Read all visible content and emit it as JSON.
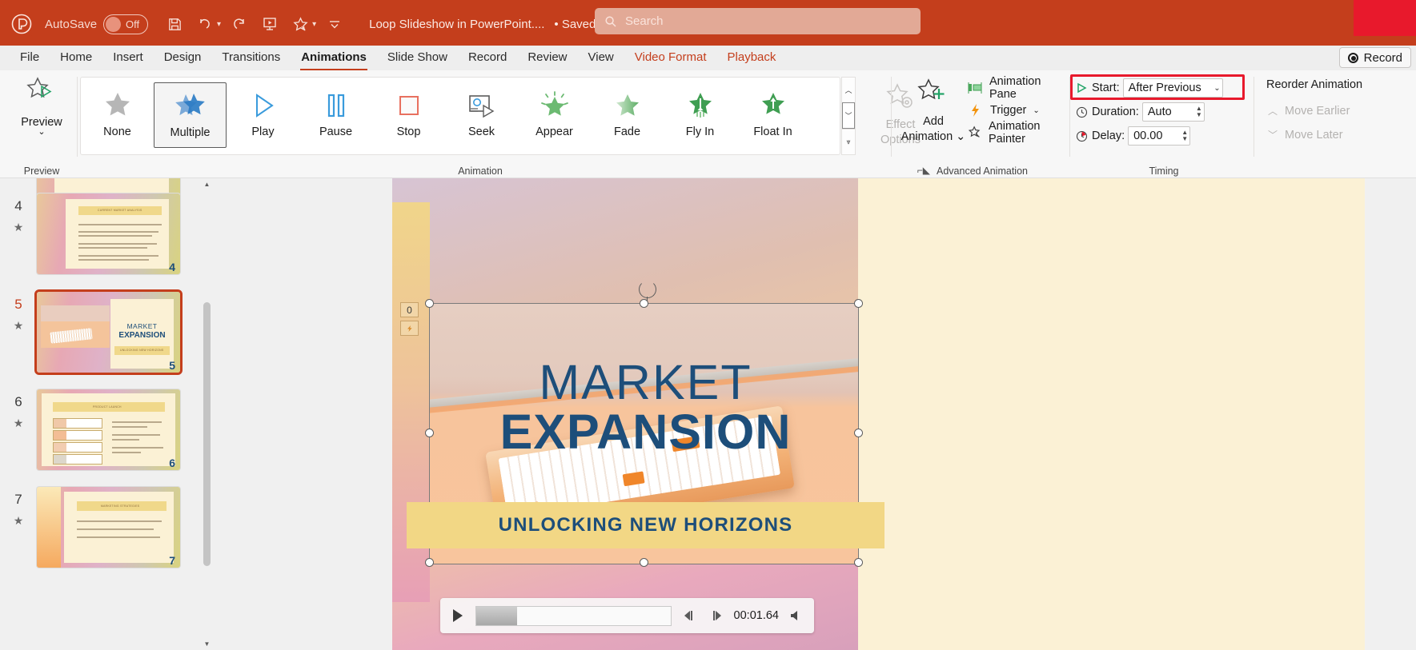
{
  "titlebar": {
    "app_icon": "powerpoint-logo-icon",
    "autosave_label": "AutoSave",
    "autosave_state": "Off",
    "quick_access": [
      {
        "name": "save-icon",
        "label": "Save"
      },
      {
        "name": "undo-icon",
        "label": "Undo"
      },
      {
        "name": "redo-icon",
        "label": "Redo"
      },
      {
        "name": "start-from-beginning-icon",
        "label": "Start From Beginning"
      },
      {
        "name": "designer-icon",
        "label": "Designer"
      },
      {
        "name": "customize-quick-access-icon",
        "label": "Customize Quick Access Toolbar"
      }
    ],
    "document_title": "Loop Slideshow in PowerPoint....",
    "saved_state": "• Saved to this PC",
    "search_placeholder": "Search",
    "accent_color": "#c43e1c"
  },
  "tabs": [
    {
      "label": "File",
      "active": false,
      "contextual": false
    },
    {
      "label": "Home",
      "active": false,
      "contextual": false
    },
    {
      "label": "Insert",
      "active": false,
      "contextual": false
    },
    {
      "label": "Design",
      "active": false,
      "contextual": false
    },
    {
      "label": "Transitions",
      "active": false,
      "contextual": false
    },
    {
      "label": "Animations",
      "active": true,
      "contextual": false
    },
    {
      "label": "Slide Show",
      "active": false,
      "contextual": false
    },
    {
      "label": "Record",
      "active": false,
      "contextual": false
    },
    {
      "label": "Review",
      "active": false,
      "contextual": false
    },
    {
      "label": "View",
      "active": false,
      "contextual": false
    },
    {
      "label": "Video Format",
      "active": false,
      "contextual": true
    },
    {
      "label": "Playback",
      "active": false,
      "contextual": true
    }
  ],
  "record_button": {
    "label": "Record"
  },
  "ribbon": {
    "preview_group": {
      "button_label": "Preview",
      "group_label": "Preview"
    },
    "animation_group": {
      "group_label": "Animation",
      "gallery": [
        {
          "label": "None",
          "icon": "grey-star-icon",
          "selected": false
        },
        {
          "label": "Multiple",
          "icon": "blue-multi-star-icon",
          "selected": true
        },
        {
          "label": "Play",
          "icon": "play-triangle-icon",
          "selected": false
        },
        {
          "label": "Pause",
          "icon": "pause-bars-icon",
          "selected": false
        },
        {
          "label": "Stop",
          "icon": "stop-square-icon",
          "selected": false
        },
        {
          "label": "Seek",
          "icon": "seek-icon",
          "selected": false
        },
        {
          "label": "Appear",
          "icon": "green-burst-star-icon",
          "selected": false
        },
        {
          "label": "Fade",
          "icon": "green-fade-star-icon",
          "selected": false
        },
        {
          "label": "Fly In",
          "icon": "green-fly-in-star-icon",
          "selected": false
        },
        {
          "label": "Float In",
          "icon": "green-float-in-star-icon",
          "selected": false
        }
      ],
      "effect_options_label_line1": "Effect",
      "effect_options_label_line2": "Options",
      "effect_options_enabled": false
    },
    "advanced_animation_group": {
      "group_label": "Advanced Animation",
      "add_animation_line1": "Add",
      "add_animation_line2": "Animation",
      "items": [
        {
          "label": "Animation Pane",
          "icon": "animation-pane-icon"
        },
        {
          "label": "Trigger",
          "icon": "trigger-lightning-icon",
          "has_caret": true
        },
        {
          "label": "Animation Painter",
          "icon": "animation-painter-icon"
        }
      ]
    },
    "timing_group": {
      "group_label": "Timing",
      "start_label": "Start:",
      "start_value": "After Previous",
      "duration_label": "Duration:",
      "duration_value": "Auto",
      "delay_label": "Delay:",
      "delay_value": "00.00",
      "highlight_color": "#e8192c"
    },
    "reorder_group": {
      "title": "Reorder Animation",
      "move_earlier": "Move Earlier",
      "move_later": "Move Later"
    }
  },
  "thumbnails": [
    {
      "number": "4",
      "selected": false,
      "type": "bullets",
      "heading": "CURRENT MARKET ANALYSIS",
      "body": "We have identified important key trends that demand our attention.",
      "bullets": [
        "Data reveals a steady increase in consumer demand for sustainable products, presenting an opportunity for our eco-friendly offerings.",
        "Our competitors are now focusing on digital marketing strategies, suggesting a shift in consumer behavior.",
        "Understanding these nuanced market dynamics positions us to adapt and capitalize on emerging market preferences."
      ]
    },
    {
      "number": "5",
      "selected": true,
      "type": "title",
      "title_line1": "MARKET",
      "title_line2": "EXPANSION",
      "cta": "UNLOCKING NEW HORIZONS"
    },
    {
      "number": "6",
      "selected": false,
      "type": "process",
      "heading": "PRODUCT LAUNCH",
      "steps": [
        {
          "code": "01",
          "label": "Market research"
        },
        {
          "code": "02",
          "label": "Product development"
        },
        {
          "code": "03",
          "label": "Marketing"
        },
        {
          "code": "04",
          "label": "Product launch"
        }
      ],
      "bullets": [
        "Currently gearing up for a groundbreaking launch.",
        "Our new offerings will captivate the market.",
        "Our marketing campaign will generate anticipation."
      ]
    },
    {
      "number": "7",
      "selected": false,
      "type": "bullets",
      "heading": "MARKETING STRATEGIES",
      "body": "",
      "bullets": []
    }
  ],
  "slide": {
    "title_line1": "MARKET",
    "title_line2": "EXPANSION",
    "cta_label": "UNLOCKING NEW HORIZONS",
    "title_color": "#1d4e7a",
    "cta_bg": "#f2d785",
    "background": "#fbf1d5",
    "animation_tags": [
      "0",
      "media-play-icon"
    ]
  },
  "video_controls": {
    "play_icon": "play-icon",
    "back_icon": "step-back-icon",
    "forward_icon": "step-forward-icon",
    "time": "00:01.64",
    "volume_icon": "volume-icon",
    "progress_percent": 21
  }
}
